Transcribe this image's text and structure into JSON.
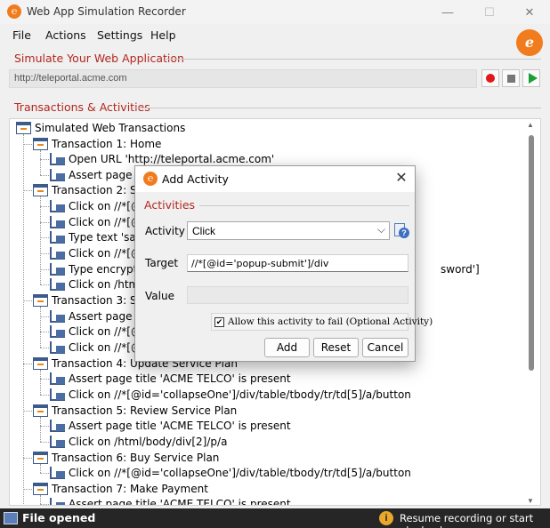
{
  "window": {
    "title": "Web App Simulation Recorder",
    "controls": {
      "minimize": "—",
      "maximize": "☐",
      "close": "✕"
    }
  },
  "menu": [
    "File",
    "Actions",
    "Settings",
    "Help"
  ],
  "simulate": {
    "title": "Simulate Your Web Application",
    "url": "http://teleportal.acme.com"
  },
  "transactions": {
    "title": "Transactions & Activities",
    "root": "Simulated Web Transactions",
    "rows": [
      {
        "kind": "trans",
        "text": "Transaction 1: Home"
      },
      {
        "kind": "act",
        "text": "Open URL 'http://teleportal.acme.com'"
      },
      {
        "kind": "act",
        "text": "Assert page title"
      },
      {
        "kind": "trans",
        "text": "Transaction 2: Sign"
      },
      {
        "kind": "act",
        "text": "Click on //*[@i"
      },
      {
        "kind": "act",
        "text": "Click on //*[@i"
      },
      {
        "kind": "act",
        "text": "Type text 'sathe"
      },
      {
        "kind": "act",
        "text": "Click on //*[@i"
      },
      {
        "kind": "act",
        "text": "Type encrypted"
      },
      {
        "kind": "act",
        "text": "Click on /html"
      },
      {
        "kind": "trans",
        "text": "Transaction 3: Sele"
      },
      {
        "kind": "act",
        "text": "Assert page title"
      },
      {
        "kind": "act",
        "text": "Click on //*[@i"
      },
      {
        "kind": "act",
        "text": "Click on //*[@i"
      },
      {
        "kind": "trans",
        "text": "Transaction 4: Update Service Plan"
      },
      {
        "kind": "act",
        "text": "Assert page title 'ACME TELCO' is present"
      },
      {
        "kind": "act",
        "text": "Click on //*[@id='collapseOne']/div/table/tbody/tr/td[5]/a/button"
      },
      {
        "kind": "trans",
        "text": "Transaction 5: Review Service Plan"
      },
      {
        "kind": "act",
        "text": "Assert page title 'ACME TELCO' is present"
      },
      {
        "kind": "act",
        "text": "Click on /html/body/div[2]/p/a"
      },
      {
        "kind": "trans",
        "text": "Transaction 6: Buy Service Plan"
      },
      {
        "kind": "act",
        "text": "Click on //*[@id='collapseOne']/div/table/tbody/tr/td[5]/a/button"
      },
      {
        "kind": "trans",
        "text": "Transaction 7: Make Payment"
      },
      {
        "kind": "act",
        "text": "Assert page title 'ACME TELCO' is present"
      }
    ],
    "overflow_text": "sword']"
  },
  "status": {
    "left": "File opened",
    "right": "Resume recording or start playback."
  },
  "dialog": {
    "title": "Add Activity",
    "group_title": "Activities",
    "activity_label": "Activity",
    "activity_value": "Click",
    "target_label": "Target",
    "target_value": "//*[@id='popup-submit']/div",
    "value_label": "Value",
    "value_value": "",
    "checkbox_label": "Allow this activity to fail (Optional Activity)",
    "checkbox_checked": true,
    "buttons": {
      "add": "Add",
      "reset": "Reset",
      "cancel": "Cancel"
    }
  },
  "colors": {
    "accent_orange": "#f07c1e",
    "section_red": "#b3261e",
    "record_red": "#e0181a",
    "play_green": "#1b9e35",
    "statusbar": "#262626"
  }
}
